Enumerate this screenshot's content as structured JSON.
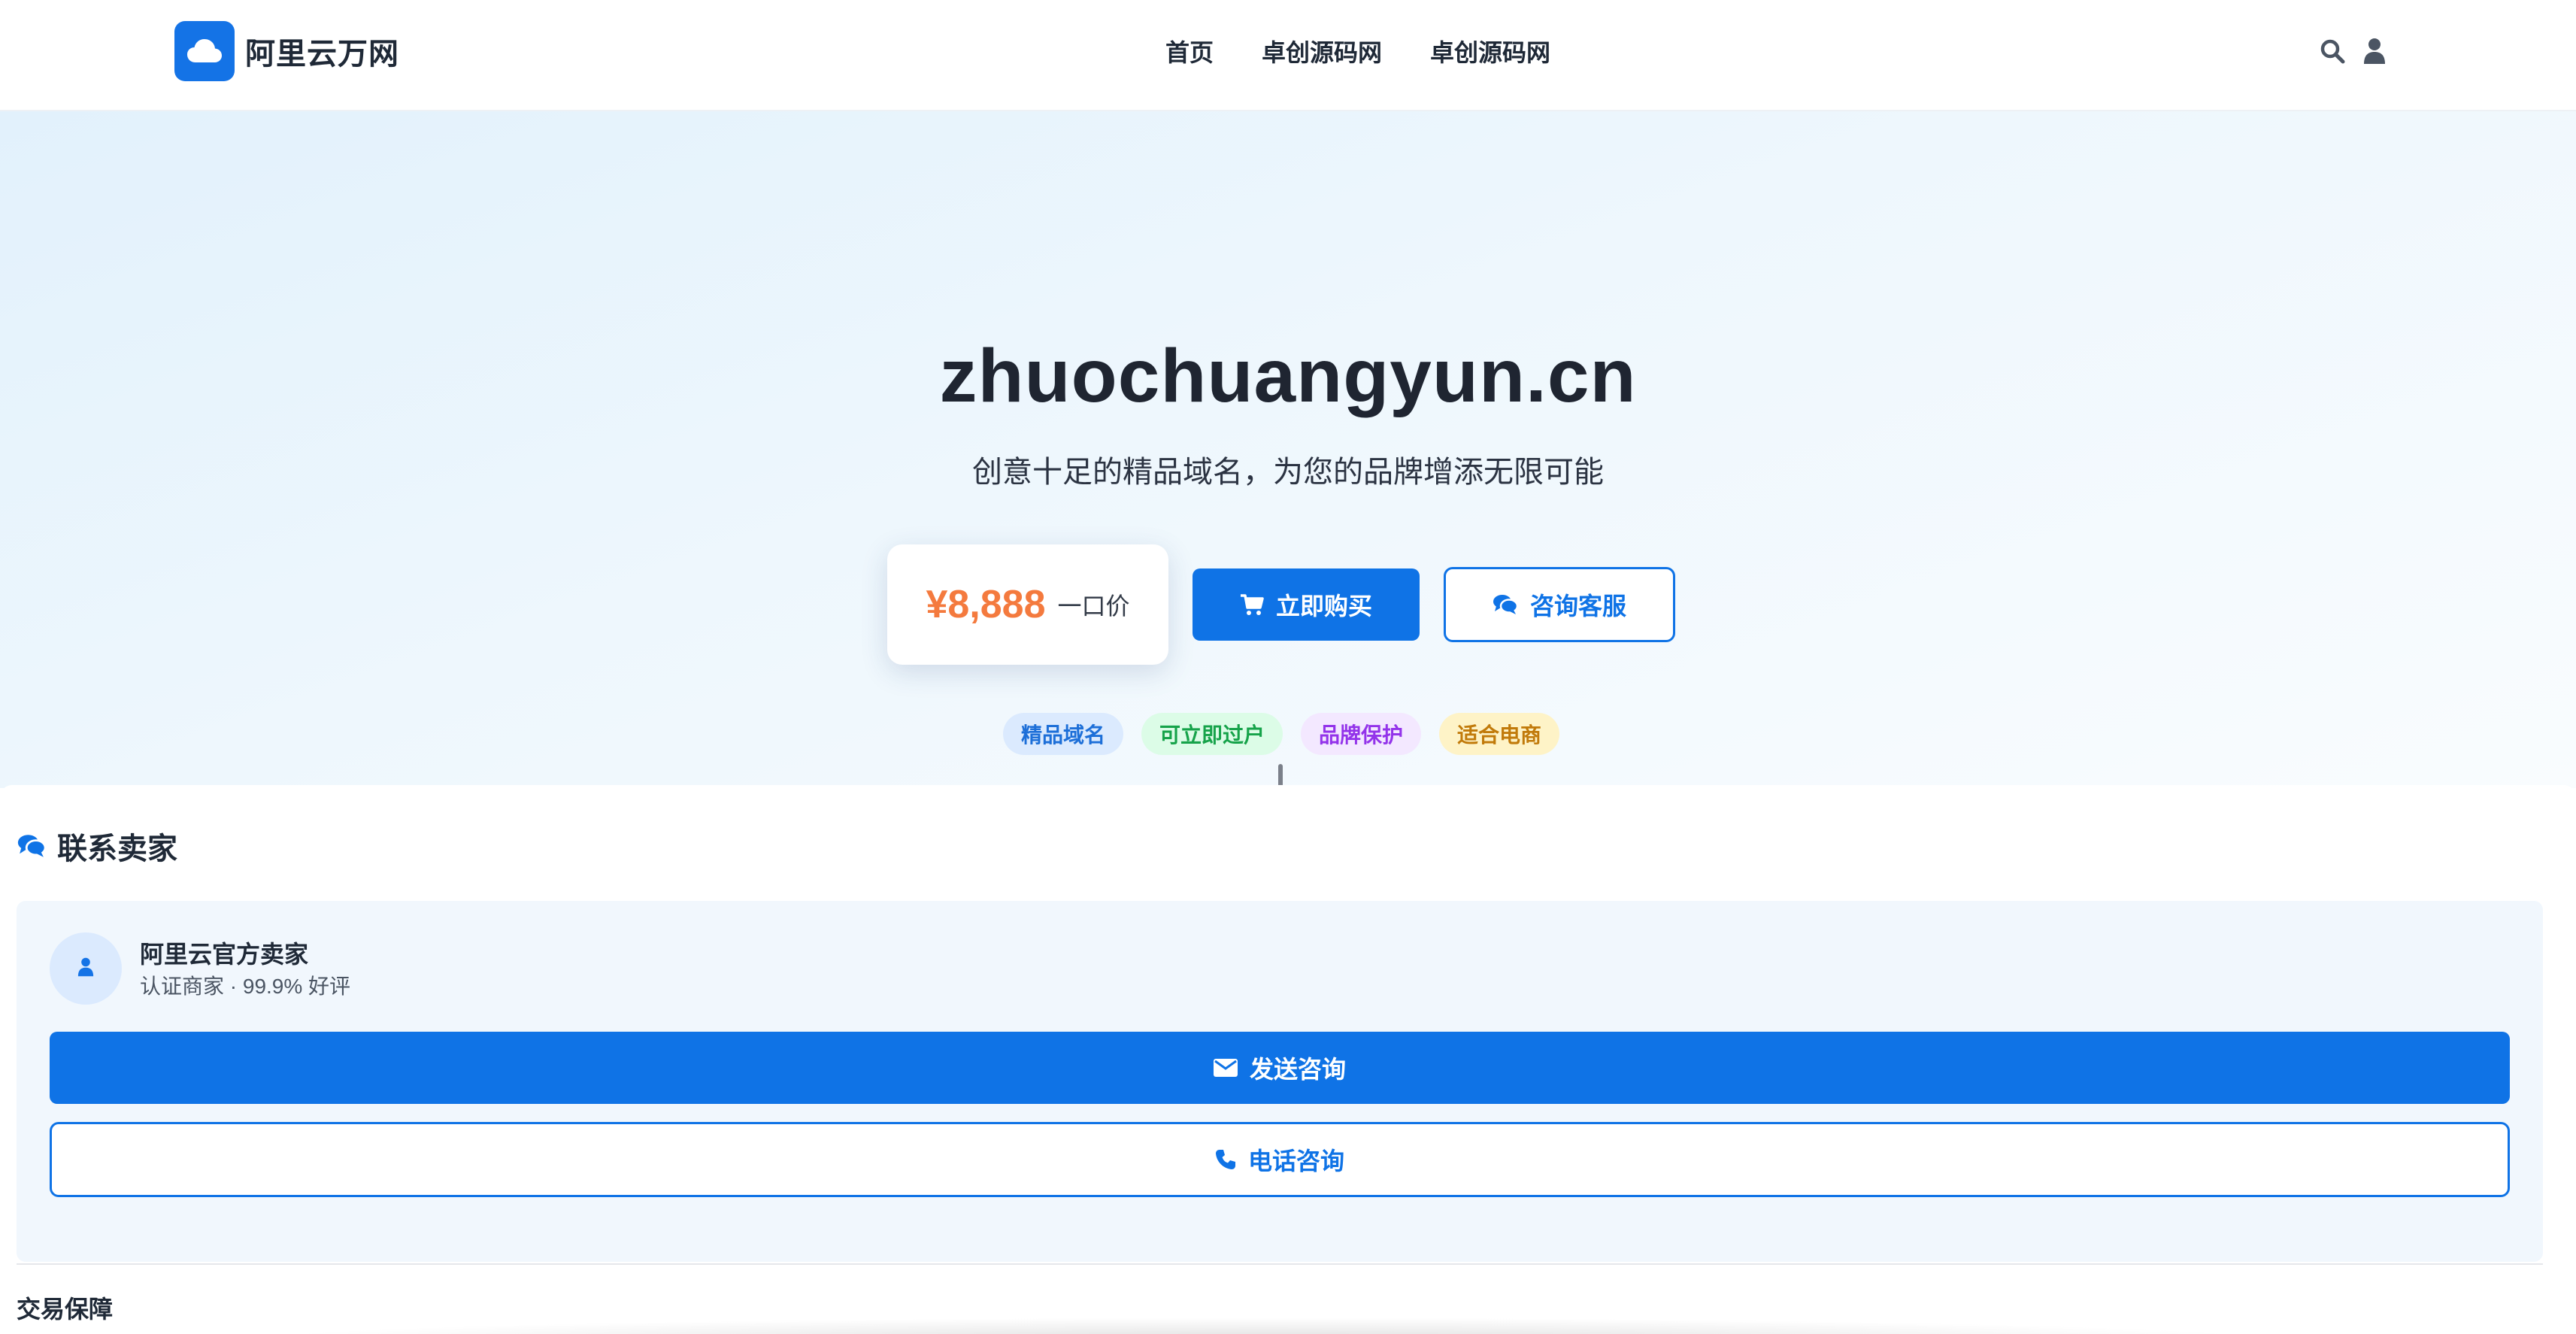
{
  "header": {
    "logo_text": "阿里云万网",
    "nav": [
      {
        "label": "首页"
      },
      {
        "label": "卓创源码网"
      },
      {
        "label": "卓创源码网"
      }
    ]
  },
  "hero": {
    "domain": "zhuochuangyun.cn",
    "subtitle": "创意十足的精品域名，为您的品牌增添无限可能",
    "price": "¥8,888",
    "price_label": "一口价",
    "buy_label": "立即购买",
    "consult_label": "咨询客服",
    "tags": [
      "精品域名",
      "可立即过户",
      "品牌保护",
      "适合电商"
    ]
  },
  "contact": {
    "title": "联系卖家",
    "seller_name": "阿里云官方卖家",
    "seller_meta": "认证商家 · 99.9% 好评",
    "send_label": "发送咨询",
    "phone_label": "电话咨询",
    "guarantee_title": "交易保障"
  },
  "icons": {
    "logo": "cloud-icon",
    "search": "search-icon",
    "user": "user-icon",
    "cart": "cart-icon",
    "chat": "chat-icon",
    "avatar": "user-icon",
    "envelope": "envelope-icon",
    "phone": "phone-icon"
  },
  "colors": {
    "brand": "#0f73e6",
    "price": "#f47a3e",
    "tag_blue": "#1d6fd8",
    "tag_green": "#16a34a",
    "tag_purple": "#9333ea",
    "tag_yellow": "#c17a0a"
  }
}
